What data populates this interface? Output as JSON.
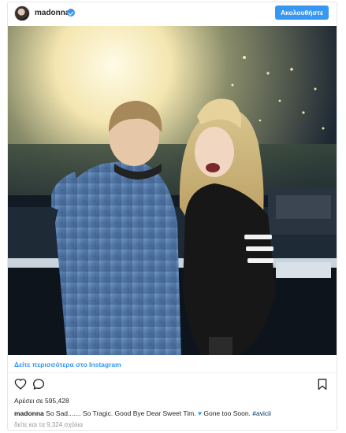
{
  "header": {
    "username": "madonna",
    "follow_label": "Ακολουθήστε"
  },
  "photo": {
    "description_icon": "photo"
  },
  "footer": {
    "view_more": "Δείτε περισσότερα στο Instagram",
    "likes": "Αρέσει σε 595,428",
    "caption_user": "madonna",
    "caption_text_1": "So Sad....... So Tragic. Good Bye Dear Sweet Tim.",
    "caption_heart": "♥",
    "caption_text_2": "Gone too Soon.",
    "caption_hashtag": "#avicii",
    "comments": "δείτε και τα 9,324 σχόλια"
  },
  "icons": {
    "like": "heart-outline-icon",
    "comment": "comment-bubble-icon",
    "save": "bookmark-icon",
    "verified": "verified-badge-icon"
  },
  "colors": {
    "accent": "#3897f0",
    "hashtag": "#003569",
    "muted": "#999999"
  }
}
